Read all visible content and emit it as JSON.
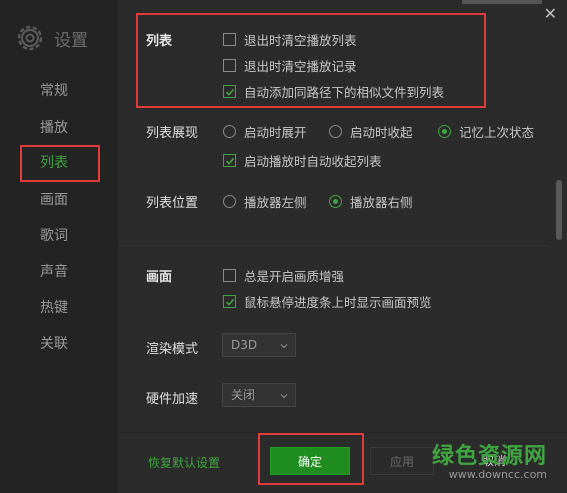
{
  "app": {
    "title": "设置"
  },
  "sidebar": {
    "items": [
      {
        "label": "常规",
        "active": false
      },
      {
        "label": "播放",
        "active": false
      },
      {
        "label": "列表",
        "active": true
      },
      {
        "label": "画面",
        "active": false
      },
      {
        "label": "歌词",
        "active": false
      },
      {
        "label": "声音",
        "active": false
      },
      {
        "label": "热键",
        "active": false
      },
      {
        "label": "关联",
        "active": false
      }
    ]
  },
  "list": {
    "title": "列表",
    "options": [
      {
        "label": "退出时清空播放列表",
        "checked": false
      },
      {
        "label": "退出时清空播放记录",
        "checked": false
      },
      {
        "label": "自动添加同路径下的相似文件到列表",
        "checked": true
      }
    ]
  },
  "list_display": {
    "label": "列表展现",
    "radios": [
      {
        "label": "启动时展开",
        "selected": false
      },
      {
        "label": "启动时收起",
        "selected": false
      },
      {
        "label": "记忆上次状态",
        "selected": true
      }
    ],
    "auto_collapse": {
      "label": "启动播放时自动收起列表",
      "checked": true
    }
  },
  "list_position": {
    "label": "列表位置",
    "radios": [
      {
        "label": "播放器左侧",
        "selected": false
      },
      {
        "label": "播放器右侧",
        "selected": true
      }
    ]
  },
  "picture": {
    "title": "画面",
    "options": [
      {
        "label": "总是开启画质增强",
        "checked": false
      },
      {
        "label": "鼠标悬停进度条上时显示画面预览",
        "checked": true
      }
    ]
  },
  "render_mode": {
    "label": "渲染模式",
    "value": "D3D"
  },
  "hw_accel": {
    "label": "硬件加速",
    "value": "关闭"
  },
  "footer": {
    "restore": "恢复默认设置",
    "ok": "确定",
    "apply": "应用",
    "cancel": "取消"
  },
  "watermark": {
    "line1": "绿色资源网",
    "line2": "www.downcc.com"
  },
  "colors": {
    "accent": "#3fa63f",
    "highlight": "#e03a3a",
    "background": "#2b2b2b",
    "sidebar": "#232323"
  }
}
